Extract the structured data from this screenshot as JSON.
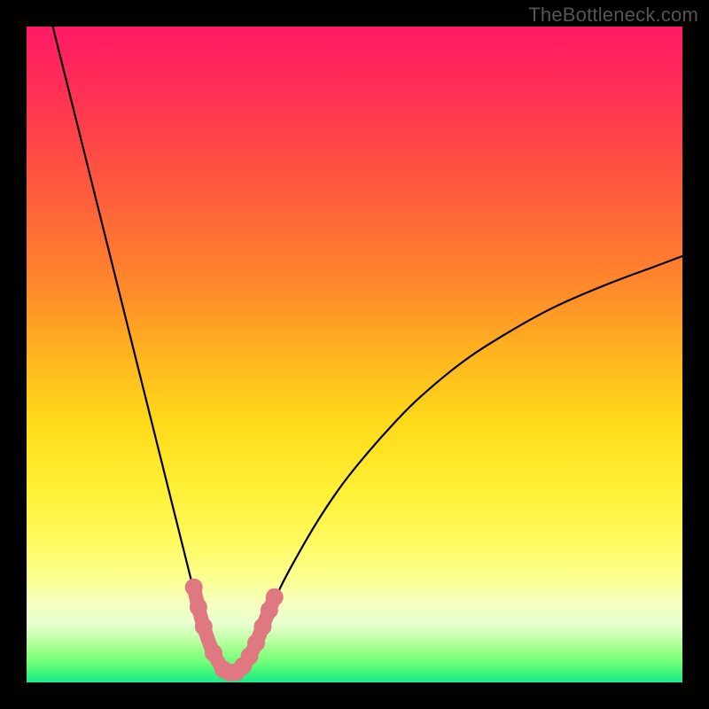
{
  "watermark": "TheBottleneck.com",
  "colors": {
    "frame": "#000000",
    "curve": "#000000",
    "marker": "#e07882",
    "gradient_top": "#ff1a66",
    "gradient_bottom": "#1de990"
  },
  "chart_data": {
    "type": "line",
    "title": "",
    "xlabel": "",
    "ylabel": "",
    "xlim": [
      0,
      100
    ],
    "ylim": [
      0,
      100
    ],
    "note": "Bottleneck characteristic V-curve. Y roughly maps percent mismatch (top=100, bottom=0). X is a normalized hardware ratio. Curve minimum near x≈31. Right branch asymptotes to ~y≈65 at x=100. Left branch starts at top-left corner.",
    "series": [
      {
        "name": "left-branch",
        "x": [
          4,
          6,
          8,
          10,
          12,
          14,
          16,
          18,
          20,
          22,
          24,
          25,
          26,
          27,
          28,
          29,
          30,
          31
        ],
        "y": [
          100,
          92,
          84,
          76,
          68,
          60,
          52,
          44,
          36,
          28,
          20,
          16,
          12,
          8.5,
          5.5,
          3.5,
          2.0,
          1.3
        ]
      },
      {
        "name": "right-branch",
        "x": [
          31,
          32,
          33,
          34,
          35,
          36,
          38,
          40,
          44,
          48,
          52,
          56,
          60,
          66,
          72,
          80,
          88,
          96,
          100
        ],
        "y": [
          1.3,
          1.8,
          2.8,
          4.2,
          6.2,
          8.5,
          13,
          17,
          24,
          30,
          35,
          39.5,
          43.5,
          48.5,
          52.5,
          57,
          60.5,
          63.5,
          65
        ]
      }
    ],
    "markers": {
      "name": "highlighted-points",
      "description": "Salmon dot cluster along the valley of the curve",
      "points": [
        {
          "x": 25.5,
          "y": 14.5
        },
        {
          "x": 26.2,
          "y": 11.5
        },
        {
          "x": 27.0,
          "y": 8.5
        },
        {
          "x": 28.5,
          "y": 4.5
        },
        {
          "x": 30.0,
          "y": 2.0
        },
        {
          "x": 31.0,
          "y": 1.5
        },
        {
          "x": 32.0,
          "y": 1.6
        },
        {
          "x": 33.0,
          "y": 2.5
        },
        {
          "x": 34.0,
          "y": 4.0
        },
        {
          "x": 35.0,
          "y": 6.0
        },
        {
          "x": 36.0,
          "y": 8.5
        },
        {
          "x": 37.0,
          "y": 11.0
        },
        {
          "x": 37.8,
          "y": 13.0
        }
      ]
    }
  }
}
